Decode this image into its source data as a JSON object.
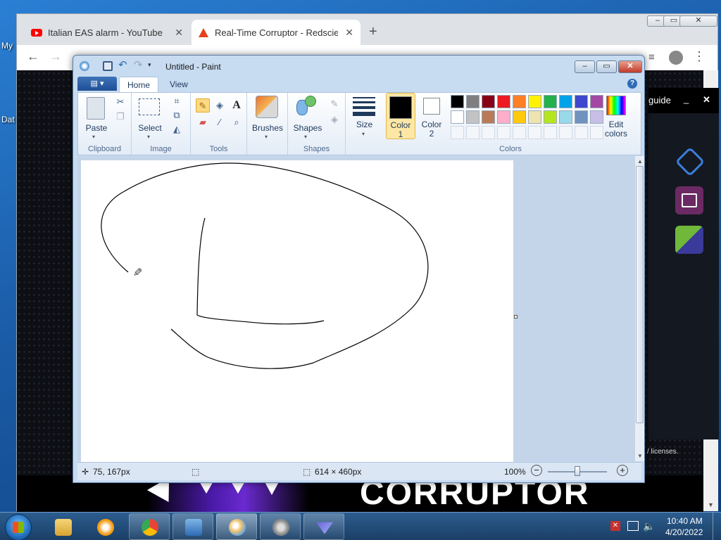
{
  "desktop": {
    "label_my": "My",
    "label_dat": "Dat"
  },
  "chrome": {
    "tabs": [
      {
        "title": "Italian EAS alarm - YouTube",
        "close": "✕"
      },
      {
        "title": "Real-Time Corruptor - Redscienti",
        "close": "✕"
      }
    ],
    "new_tab": "+",
    "guide_text": "guide",
    "guide_min": "_",
    "guide_close": "✕",
    "licenses_text": "/ licenses.",
    "banner_text": "CORRUPTOR"
  },
  "paint": {
    "title": "Untitled - Paint",
    "tabs": {
      "home": "Home",
      "view": "View"
    },
    "help": "?",
    "groups": {
      "clipboard": {
        "label": "Clipboard",
        "paste": "Paste"
      },
      "image": {
        "label": "Image",
        "select": "Select"
      },
      "tools": {
        "label": "Tools"
      },
      "brushes": {
        "label": "Brushes"
      },
      "shapes": {
        "label": "Shapes",
        "shapes_btn": "Shapes"
      },
      "size": {
        "label": "Size"
      },
      "colors": {
        "label": "Colors",
        "color1": "Color\n1",
        "color1_a": "Color",
        "color1_b": "1",
        "color2_a": "Color",
        "color2_b": "2",
        "edit_a": "Edit",
        "edit_b": "colors",
        "palette_row1": [
          "#000000",
          "#7f7f7f",
          "#880015",
          "#ed1c24",
          "#ff7f27",
          "#fff200",
          "#22b14c",
          "#00a2e8",
          "#3f48cc",
          "#a349a4"
        ],
        "palette_row2": [
          "#ffffff",
          "#c3c3c3",
          "#b97a57",
          "#ffaec9",
          "#ffc90e",
          "#efe4b0",
          "#b5e61d",
          "#99d9ea",
          "#7092be",
          "#c8bfe7"
        ]
      }
    },
    "status": {
      "cursor_pos": "75, 167px",
      "image_size": "614 × 460px",
      "zoom": "100%"
    }
  },
  "taskbar": {
    "time": "10:40 AM",
    "date": "4/20/2022"
  }
}
